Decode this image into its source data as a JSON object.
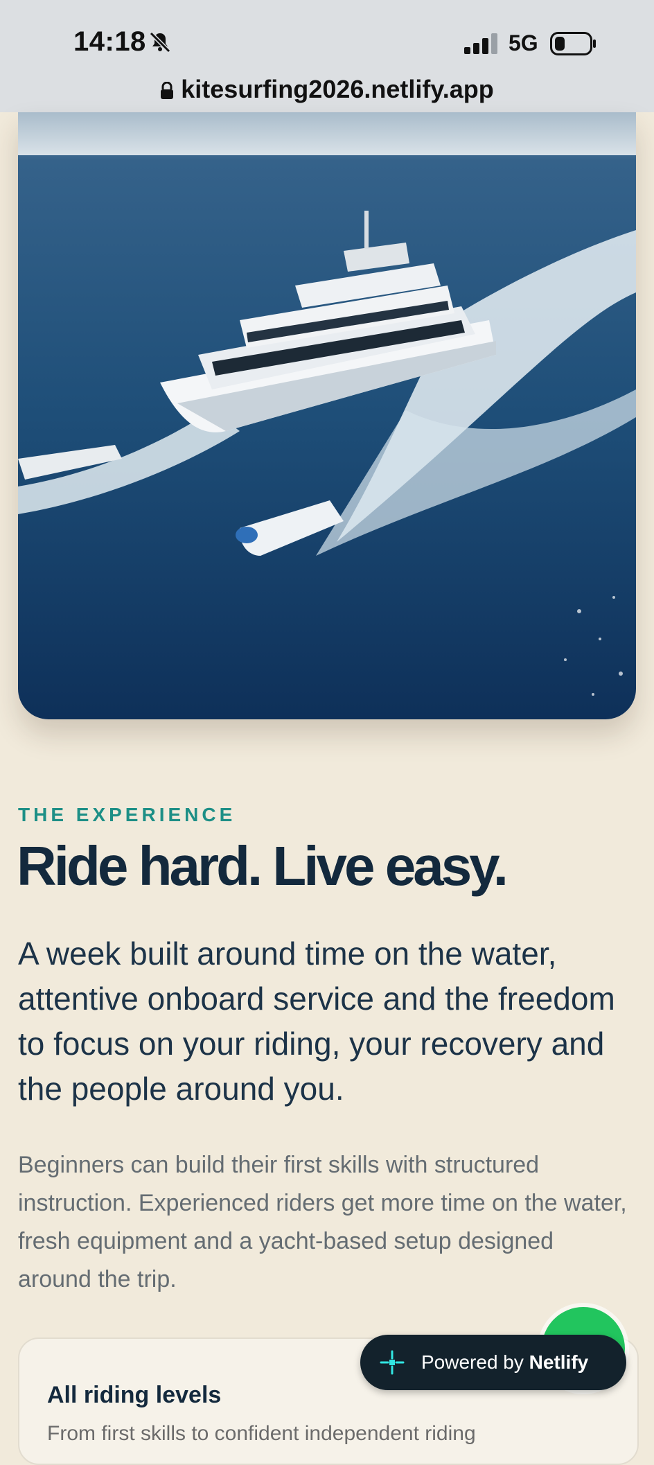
{
  "status_bar": {
    "time": "14:18",
    "network": "5G",
    "icons": [
      "bell-muted-icon",
      "signal-icon",
      "battery-icon"
    ]
  },
  "browser": {
    "url": "kitesurfing2026.netlify.app"
  },
  "section": {
    "eyebrow": "THE EXPERIENCE",
    "headline": "Ride hard. Live easy.",
    "lead": "A week built around time on the water, attentive onboard service and the freedom to focus on your riding, your recovery and the people around you.",
    "body": "Beginners can build their first skills with structured instruction. Experienced riders get more time on the water, fresh equipment and a yacht-based setup designed around the trip."
  },
  "card": {
    "title": "All riding levels",
    "subtitle": "From first skills to confident independent riding"
  },
  "netlify_badge": {
    "prefix": "Powered by",
    "brand": "Netlify"
  },
  "colors": {
    "background": "#f1eadb",
    "accent": "#1d8f86",
    "heading": "#13293d",
    "fab": "#22c55e"
  }
}
